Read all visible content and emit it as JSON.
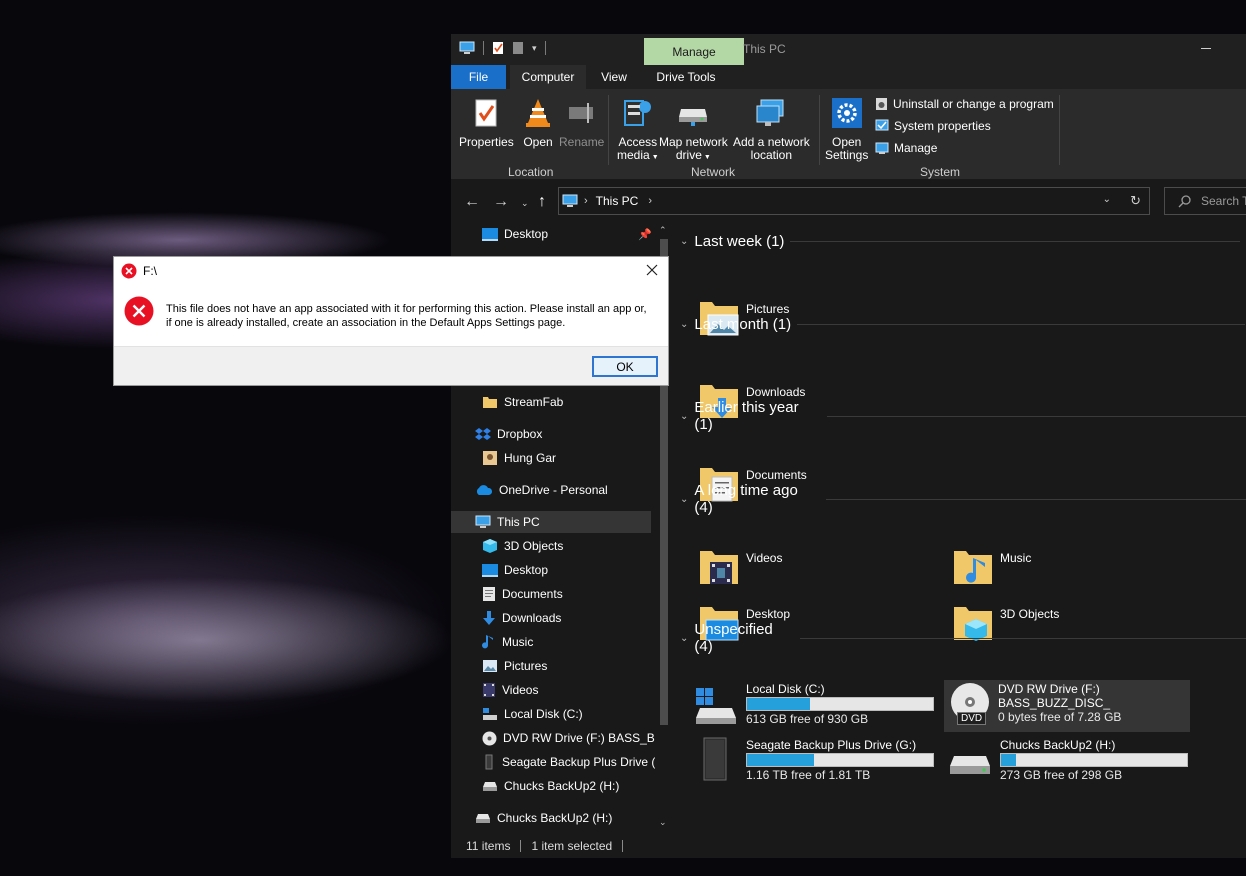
{
  "window": {
    "title": "This PC",
    "context_tab": "Manage",
    "tabs": {
      "file": "File",
      "computer": "Computer",
      "view": "View",
      "drive_tools": "Drive Tools"
    }
  },
  "ribbon": {
    "location": {
      "label": "Location",
      "properties": "Properties",
      "open": "Open",
      "rename": "Rename"
    },
    "network": {
      "label": "Network",
      "access_media_1": "Access",
      "access_media_2": "media",
      "map_drive_1": "Map network",
      "map_drive_2": "drive",
      "add_location_1": "Add a network",
      "add_location_2": "location"
    },
    "system": {
      "label": "System",
      "open_settings_1": "Open",
      "open_settings_2": "Settings",
      "uninstall": "Uninstall or change a program",
      "system_properties": "System properties",
      "manage": "Manage"
    }
  },
  "address": {
    "path": "This PC",
    "search_placeholder": "Search T"
  },
  "nav": {
    "desktop_pinned": "Desktop",
    "streamfab": "StreamFab",
    "dropbox": "Dropbox",
    "hung_gar": "Hung Gar",
    "onedrive": "OneDrive - Personal",
    "this_pc": "This PC",
    "objects3d": "3D Objects",
    "desktop": "Desktop",
    "documents": "Documents",
    "downloads": "Downloads",
    "music": "Music",
    "pictures": "Pictures",
    "videos": "Videos",
    "local_disk": "Local Disk (C:)",
    "dvd": "DVD RW Drive (F:) BASS_BUZZ",
    "seagate": "Seagate Backup Plus Drive (G",
    "chucks": "Chucks BackUp2 (H:)",
    "chucks2": "Chucks BackUp2 (H:)"
  },
  "groups": {
    "last_week": "Last week (1)",
    "last_month": "Last month (1)",
    "earlier_year": "Earlier this year (1)",
    "long_ago": "A long time ago (4)",
    "unspecified": "Unspecified (4)"
  },
  "folders": {
    "pictures": "Pictures",
    "downloads": "Downloads",
    "documents": "Documents",
    "videos": "Videos",
    "music": "Music",
    "desktop": "Desktop",
    "objects3d": "3D Objects"
  },
  "drives": [
    {
      "name": "Local Disk (C:)",
      "free": "613 GB free of 930 GB",
      "used_fraction": 0.34
    },
    {
      "name": "DVD RW Drive (F:)",
      "label": "BASS_BUZZ_DISC_",
      "free": "0 bytes free of 7.28 GB",
      "badge": "DVD"
    },
    {
      "name": "Seagate Backup Plus Drive (G:)",
      "free": "1.16 TB free of 1.81 TB",
      "used_fraction": 0.36
    },
    {
      "name": "Chucks BackUp2 (H:)",
      "free": "273 GB free of 298 GB",
      "used_fraction": 0.08
    }
  ],
  "status": {
    "items": "11 items",
    "selected": "1 item selected"
  },
  "dialog": {
    "title": "F:\\",
    "message": "This file does not have an app associated with it for performing this action. Please install an app or, if one is already installed, create an association in the Default Apps Settings page.",
    "ok": "OK"
  },
  "colors": {
    "accent": "#1a6fc9",
    "manage_tab": "#b4d7a6",
    "drive_bar": "#26a0da",
    "error_red": "#e81123"
  }
}
